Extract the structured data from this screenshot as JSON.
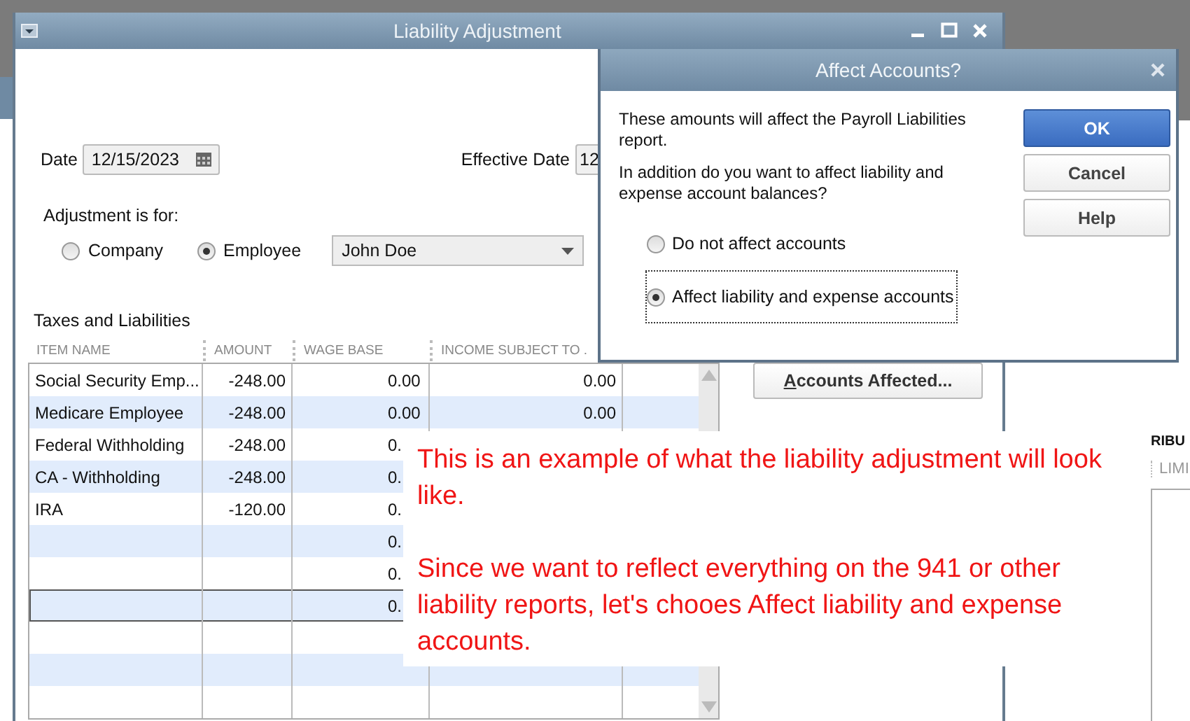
{
  "main_window": {
    "title": "Liability Adjustment",
    "date": {
      "label": "Date",
      "value": "12/15/2023"
    },
    "effective_date": {
      "label": "Effective Date",
      "value": "12"
    },
    "adjustment_for": {
      "label": "Adjustment is for:",
      "options": [
        {
          "label": "Company",
          "selected": false
        },
        {
          "label": "Employee",
          "selected": true
        }
      ],
      "employee": "John Doe"
    },
    "section_title": "Taxes and Liabilities",
    "table": {
      "columns": [
        "ITEM NAME",
        "AMOUNT",
        "WAGE BASE",
        "INCOME SUBJECT TO ."
      ],
      "rows": [
        {
          "item": "Social Security Emp...",
          "amount": "-248.00",
          "wage_base": "0.00",
          "income_subject": "0.00",
          "selected": false
        },
        {
          "item": "Medicare Employee",
          "amount": "-248.00",
          "wage_base": "0.00",
          "income_subject": "0.00",
          "selected": false
        },
        {
          "item": "Federal Withholding",
          "amount": "-248.00",
          "wage_base": "0.",
          "selected": false
        },
        {
          "item": "CA - Withholding",
          "amount": "-248.00",
          "wage_base": "0.",
          "selected": false
        },
        {
          "item": "IRA",
          "amount": "-120.00",
          "wage_base": "0.",
          "selected": false
        },
        {
          "wage_base": "0.",
          "selected": false
        },
        {
          "wage_base": "0.",
          "selected": false
        },
        {
          "wage_base": "0.",
          "selected": true
        },
        {
          "selected": false
        },
        {
          "selected": false
        },
        {
          "selected": false
        }
      ]
    },
    "accounts_affected_button": "Accounts Affected..."
  },
  "dialog": {
    "title": "Affect Accounts?",
    "message": "These amounts will affect the Payroll Liabilities report.",
    "question": "In addition do you want to affect liability and expense account balances?",
    "options": [
      {
        "label": "Do not affect accounts",
        "selected": false
      },
      {
        "label": "Affect liability and expense accounts",
        "selected": true
      }
    ],
    "buttons": [
      {
        "label": "OK",
        "default": true
      },
      {
        "label": "Cancel",
        "default": false
      },
      {
        "label": "Help",
        "default": false
      }
    ]
  },
  "annotation": {
    "paragraphs": [
      "This is an example of what the liability adjustment will look like.",
      "Since we want to reflect everything on the 941 or other liability reports, let's chooes Affect liability and expense accounts."
    ]
  },
  "right_window": {
    "heading": "RIBU",
    "column": "LIMI"
  }
}
